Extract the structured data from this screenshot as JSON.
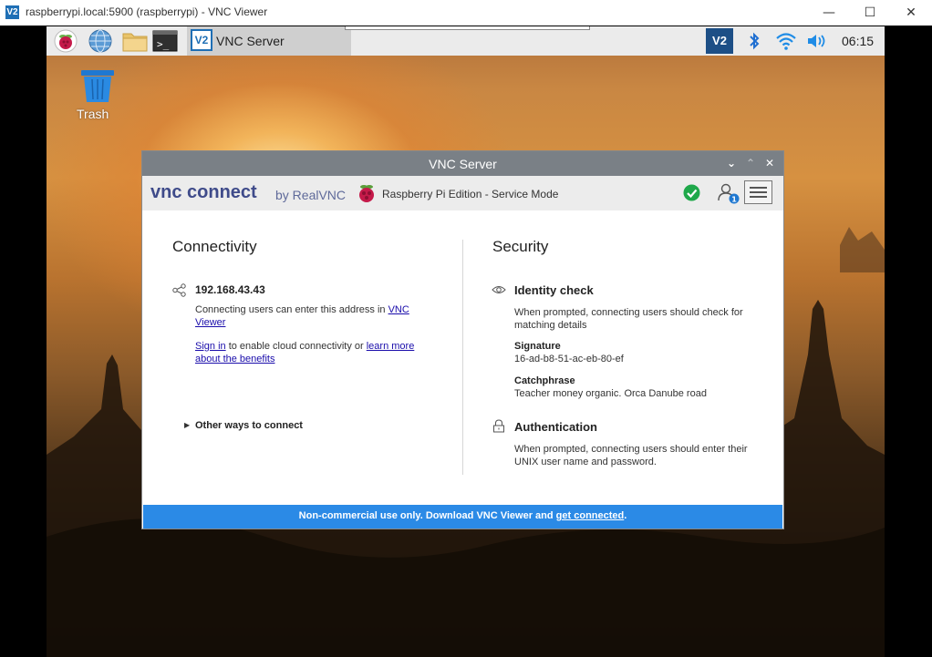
{
  "window": {
    "app_icon": "V2",
    "title": "raspberrypi.local:5900 (raspberrypi) - VNC Viewer",
    "minimize": "—",
    "maximize": "☐",
    "close": "✕"
  },
  "taskbar": {
    "task_label": "VNC Server",
    "task_icon_text": "V2",
    "tray_vnc_text": "V2",
    "clock": "06:15",
    "icons": [
      "raspberry-menu-icon",
      "web-browser-icon",
      "file-manager-icon",
      "terminal-icon",
      "bluetooth-icon",
      "wifi-icon",
      "volume-icon"
    ]
  },
  "desktop": {
    "trash_label": "Trash"
  },
  "dialog": {
    "title": "VNC Server",
    "brand_vnc": "vnc connect",
    "brand_by": "by RealVNC",
    "edition": "Raspberry Pi Edition - Service Mode",
    "user_badge": "1",
    "connectivity": {
      "heading": "Connectivity",
      "address": "192.168.43.43",
      "desc_prefix": "Connecting users can enter this address in ",
      "desc_link": "VNC Viewer",
      "signin_link": "Sign in",
      "signin_mid": " to enable cloud connectivity or ",
      "learn_link": "learn more about the benefits",
      "other_ways": "Other ways to connect"
    },
    "security": {
      "heading": "Security",
      "identity_title": "Identity check",
      "identity_desc": "When prompted, connecting users should check for matching details",
      "signature_label": "Signature",
      "signature_value": "16-ad-b8-51-ac-eb-80-ef",
      "catchphrase_label": "Catchphrase",
      "catchphrase_value": "Teacher money organic. Orca Danube road",
      "auth_title": "Authentication",
      "auth_desc": "When prompted, connecting users should enter their UNIX user name and password."
    },
    "footer": {
      "text": "Non-commercial use only. Download VNC Viewer and ",
      "link": "get connected",
      "suffix": "."
    }
  },
  "colors": {
    "footer_bg": "#2b8ae6",
    "dialog_titlebar": "#7a8086",
    "brand": "#3f4b8a",
    "status_ok": "#1fa84a"
  }
}
